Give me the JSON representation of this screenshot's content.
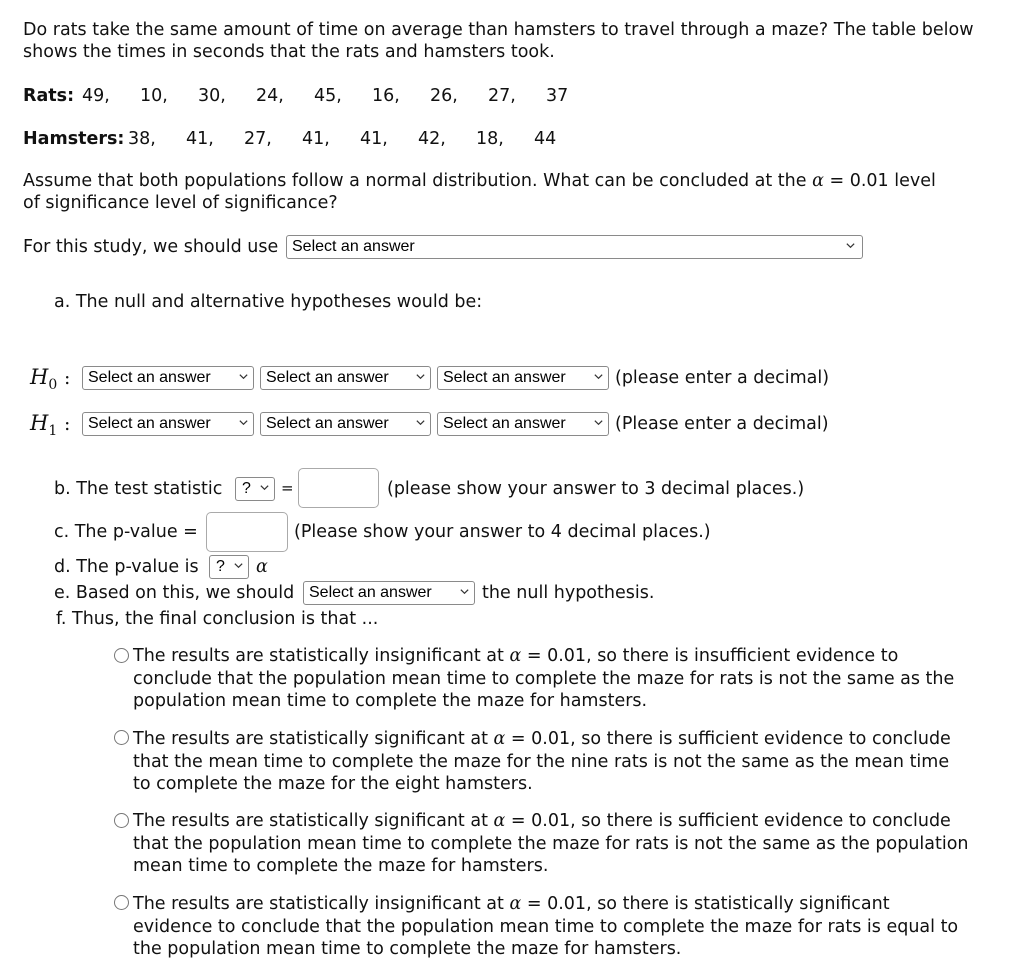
{
  "question": {
    "intro_line1": "Do rats take the same amount of time on average than hamsters to travel through a maze? The table below",
    "intro_line2": "shows the times in seconds that the rats and hamsters took.",
    "rats_label": "Rats:",
    "rats_values": [
      "49,",
      "10,",
      "30,",
      "24,",
      "45,",
      "16,",
      "26,",
      "27,",
      "37"
    ],
    "hamsters_label": "Hamsters:",
    "hamsters_values": [
      "38,",
      "41,",
      "27,",
      "41,",
      "41,",
      "42,",
      "18,",
      "44"
    ],
    "assume_line1_a": "Assume that both populations follow a normal distribution.  What can be concluded at  the",
    "alpha_symbol": "α",
    "assume_line1_b": "= 0.01 level",
    "assume_line2": "of significance level of significance?",
    "study_label": "For this study, we should use",
    "study_select": "Select an answer"
  },
  "part_a": {
    "label": "a. The null and alternative hypotheses would be:",
    "h0": {
      "symbol": "H",
      "sub": "0",
      "colon": ":",
      "selects": [
        "Select an answer",
        "Select an answer",
        "Select an answer"
      ],
      "hint": "(please enter a decimal)"
    },
    "h1": {
      "symbol": "H",
      "sub": "1",
      "colon": ":",
      "selects": [
        "Select an answer",
        "Select an answer",
        "Select an answer"
      ],
      "hint": "(Please enter a decimal)"
    }
  },
  "part_b": {
    "label": "b. The test statistic",
    "select": "?",
    "equals": "=",
    "value": "",
    "hint": "(please show your answer to 3 decimal places.)"
  },
  "part_c": {
    "label": "c. The p-value =",
    "value": "",
    "hint": "(Please show your answer to 4 decimal places.)"
  },
  "part_d": {
    "label": "d. The p-value is",
    "select": "?",
    "alpha": "α"
  },
  "part_e": {
    "label": "e. Based on this, we should",
    "select": "Select an answer",
    "suffix": "the null hypothesis."
  },
  "part_f": {
    "label": "f. Thus, the final conclusion is that ...",
    "options": [
      {
        "l1a": "The results are statistically insignificant at",
        "l1b": "= 0.01, so there is insufficient evidence to",
        "l2": "conclude that the population mean time to complete the maze for rats is not the same as the",
        "l3": "population mean time to complete the maze for hamsters.",
        "selected": false
      },
      {
        "l1a": "The results are statistically significant at",
        "l1b": "= 0.01, so there is sufficient evidence to conclude",
        "l2": "that the mean time to complete the maze for the nine rats is not the same as the mean time",
        "l3": "to complete the maze for the eight hamsters.",
        "selected": false
      },
      {
        "l1a": "The results are statistically significant at",
        "l1b": "= 0.01, so there is sufficient evidence to conclude",
        "l2": "that the population mean time to complete the maze for rats is not the same as the population",
        "l3": "mean time to complete the maze for hamsters.",
        "selected": false
      },
      {
        "l1a": "The results are statistically insignificant at",
        "l1b": "= 0.01, so there is statistically significant",
        "l2": "evidence to conclude that the population mean time to complete the maze for rats is equal to",
        "l3": "the population mean time to complete the maze for hamsters.",
        "selected": false
      }
    ]
  }
}
